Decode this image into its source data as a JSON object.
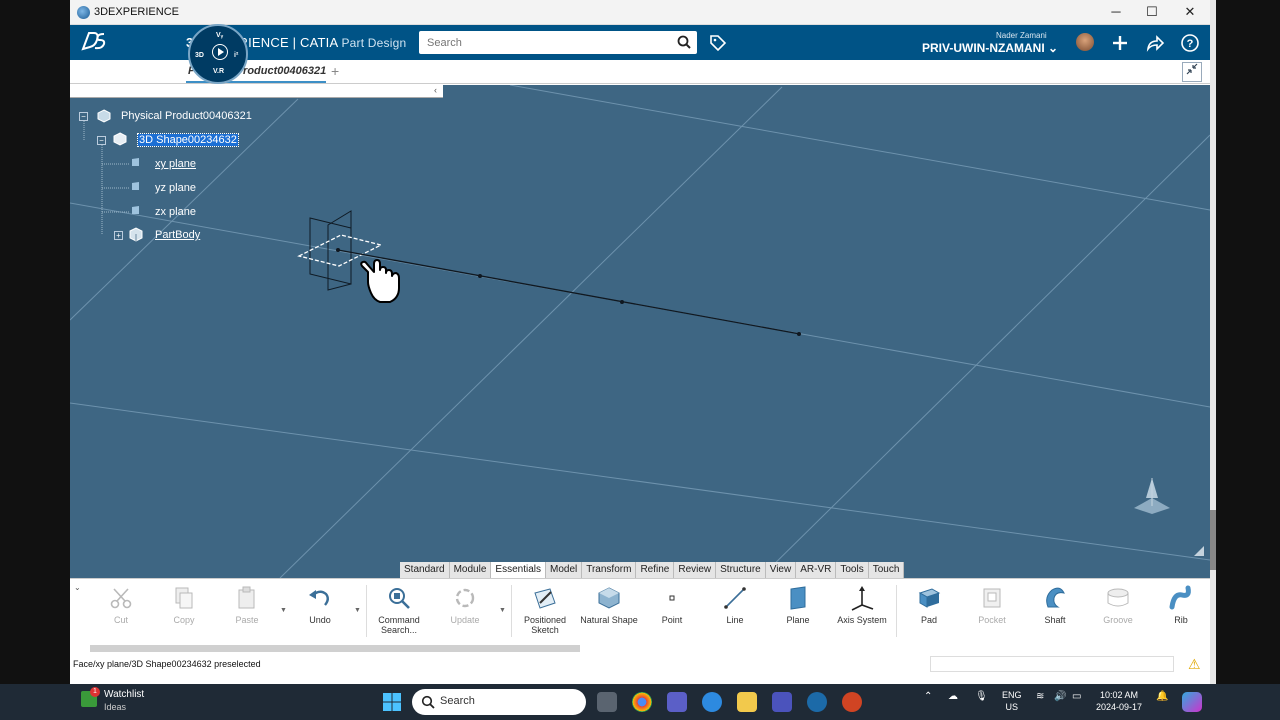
{
  "window": {
    "title": "3DEXPERIENCE",
    "minimize_glyph": "─",
    "maximize_glyph": "☐",
    "close_glyph": "✕"
  },
  "topbar": {
    "brand_prefix": "3D",
    "brand_main": "EXPERIENCE | CATIA",
    "brand_app": "Part Design",
    "compass": {
      "top": "3D",
      "left": "3D",
      "bottom": "V.R",
      "right": "i²",
      "top_label": "Vᵧ"
    },
    "search_placeholder": "Search",
    "user_name": "Nader Zamani",
    "workspace": "PRIV-UWIN-NZAMANI",
    "workspace_caret": "⌄"
  },
  "tabs": {
    "active_tab": "Physical Product00406321",
    "add_glyph": "+"
  },
  "tree": {
    "collapse_glyph": "‹",
    "root": "Physical Product00406321",
    "shape": "3D Shape00234632",
    "items": [
      "xy plane",
      "yz plane",
      "zx plane"
    ],
    "body": "PartBody"
  },
  "action_tabs": [
    "Standard",
    "Module",
    "Essentials",
    "Model",
    "Transform",
    "Refine",
    "Review",
    "Structure",
    "View",
    "AR-VR",
    "Tools",
    "Touch"
  ],
  "action_tabs_active": "Essentials",
  "tools": [
    {
      "label": "Cut",
      "icon": "scissors-icon",
      "enabled": false
    },
    {
      "label": "Copy",
      "icon": "copy-icon",
      "enabled": false
    },
    {
      "label": "Paste",
      "icon": "paste-icon",
      "enabled": false
    },
    {
      "label": "Undo",
      "icon": "undo-icon",
      "enabled": true
    },
    {
      "label": "Command Search...",
      "icon": "command-search-icon",
      "enabled": true
    },
    {
      "label": "Update",
      "icon": "update-icon",
      "enabled": false
    },
    {
      "label": "Positioned Sketch",
      "icon": "positioned-sketch-icon",
      "enabled": true
    },
    {
      "label": "Natural Shape",
      "icon": "natural-shape-icon",
      "enabled": true
    },
    {
      "label": "Point",
      "icon": "point-icon",
      "enabled": true
    },
    {
      "label": "Line",
      "icon": "line-icon",
      "enabled": true
    },
    {
      "label": "Plane",
      "icon": "plane-icon",
      "enabled": true
    },
    {
      "label": "Axis System",
      "icon": "axis-system-icon",
      "enabled": true
    },
    {
      "label": "Pad",
      "icon": "pad-icon",
      "enabled": true
    },
    {
      "label": "Pocket",
      "icon": "pocket-icon",
      "enabled": false
    },
    {
      "label": "Shaft",
      "icon": "shaft-icon",
      "enabled": true
    },
    {
      "label": "Groove",
      "icon": "groove-icon",
      "enabled": false
    },
    {
      "label": "Rib",
      "icon": "rib-icon",
      "enabled": true
    }
  ],
  "status": {
    "message": "Face/xy plane/3D Shape00234632 preselected",
    "warning_glyph": "⚠"
  },
  "taskbar": {
    "watchlist_title": "Watchlist",
    "watchlist_sub": "Ideas",
    "watchlist_badge": "1",
    "search_label": "Search",
    "lang_top": "ENG",
    "lang_bottom": "US",
    "time": "10:02 AM",
    "date": "2024-09-17"
  },
  "colors": {
    "banner": "#005386",
    "viewport": "#3e6683",
    "accent": "#3d8fc6",
    "selection": "#1c6fd4"
  }
}
